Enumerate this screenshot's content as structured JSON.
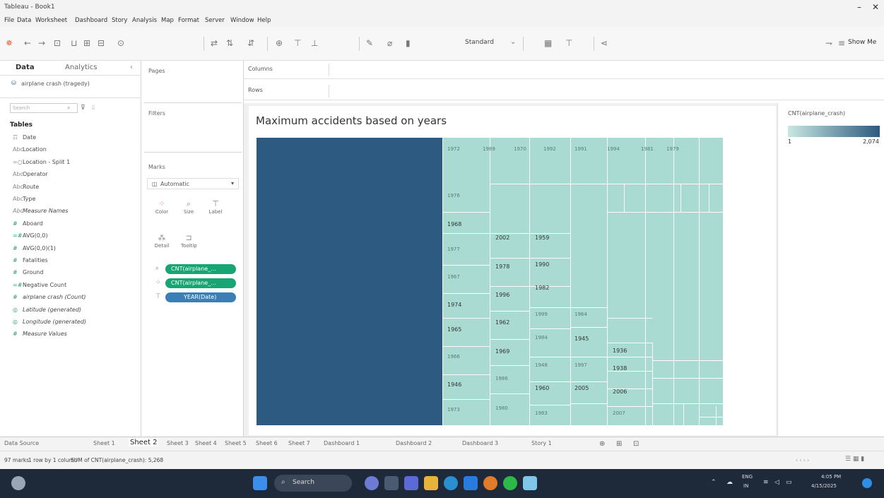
{
  "window": {
    "title": "Tableau - Book1",
    "minimize": "–",
    "close": "✕"
  },
  "menu": [
    "File",
    "Data",
    "Worksheet",
    "Dashboard",
    "Story",
    "Analysis",
    "Map",
    "Format",
    "Server",
    "Window",
    "Help"
  ],
  "toolbar": {
    "fit": "Standard",
    "show_me": "Show Me"
  },
  "left_panel": {
    "tab_data": "Data",
    "tab_analytics": "Analytics",
    "datasource": "airplane crash (tragedy)",
    "search_placeholder": "Search",
    "tables_header": "Tables",
    "fields": [
      {
        "icon": "calendar-icon",
        "glyph": "☶",
        "label": "Date",
        "italic": false
      },
      {
        "icon": "string-icon",
        "glyph": "Abc",
        "label": "Location",
        "italic": false
      },
      {
        "icon": "split-icon",
        "glyph": "=○",
        "label": "Location - Split 1",
        "italic": false
      },
      {
        "icon": "string-icon",
        "glyph": "Abc",
        "label": "Operator",
        "italic": false
      },
      {
        "icon": "string-icon",
        "glyph": "Abc",
        "label": "Route",
        "italic": false
      },
      {
        "icon": "string-icon",
        "glyph": "Abc",
        "label": "Type",
        "italic": false
      },
      {
        "icon": "string-icon",
        "glyph": "Abc",
        "label": "Measure Names",
        "italic": true
      },
      {
        "icon": "measure-icon",
        "glyph": "#",
        "label": "Aboard",
        "italic": false
      },
      {
        "icon": "calc-icon",
        "glyph": "=#",
        "label": "AVG(0,0)",
        "italic": false
      },
      {
        "icon": "measure-icon",
        "glyph": "#",
        "label": "AVG(0,0)(1)",
        "italic": false
      },
      {
        "icon": "measure-icon",
        "glyph": "#",
        "label": "Fatalities",
        "italic": false
      },
      {
        "icon": "measure-icon",
        "glyph": "#",
        "label": "Ground",
        "italic": false
      },
      {
        "icon": "calc-icon",
        "glyph": "=#",
        "label": "Negative Count",
        "italic": false
      },
      {
        "icon": "measure-icon",
        "glyph": "#",
        "label": "airplane crash (Count)",
        "italic": true
      },
      {
        "icon": "geo-icon",
        "glyph": "◎",
        "label": "Latitude (generated)",
        "italic": true
      },
      {
        "icon": "geo-icon",
        "glyph": "◎",
        "label": "Longitude (generated)",
        "italic": true
      },
      {
        "icon": "measure-icon",
        "glyph": "#",
        "label": "Measure Values",
        "italic": true
      }
    ]
  },
  "cards": {
    "pages": "Pages",
    "filters": "Filters",
    "marks": "Marks",
    "mark_type": "Automatic",
    "buttons": [
      "Color",
      "Size",
      "Label",
      "Detail",
      "Tooltip"
    ],
    "pills": [
      {
        "label": "CNT(airplane_...",
        "color": "green"
      },
      {
        "label": "CNT(airplane_...",
        "color": "green"
      },
      {
        "label": "YEAR(Date)",
        "color": "blue"
      }
    ]
  },
  "shelves": {
    "columns": "Columns",
    "rows": "Rows"
  },
  "chart_data": {
    "type": "treemap",
    "title": "Maximum accidents based on years",
    "visible_year_labels": [
      "1972",
      "1989",
      "1970",
      "1992",
      "1991",
      "1994",
      "1981",
      "1979",
      "1976",
      "1968",
      "1977",
      "1967",
      "1974",
      "1965",
      "1966",
      "1946",
      "1973",
      "2002",
      "1978",
      "1996",
      "1962",
      "1969",
      "1986",
      "1980",
      "1959",
      "1990",
      "1982",
      "1999",
      "1984",
      "1948",
      "1960",
      "1983",
      "1964",
      "1945",
      "1997",
      "2005",
      "1936",
      "1938",
      "2006",
      "2007"
    ],
    "legend": {
      "title": "CNT(airplane_crash)",
      "min": "1",
      "max": "2,074",
      "color_min": "#c8e8e2",
      "color_max": "#2c5a80"
    }
  },
  "sheet_tabs": [
    "Data Source",
    "Sheet 1",
    "Sheet 2",
    "Sheet 3",
    "Sheet 4",
    "Sheet 5",
    "Sheet 6",
    "Sheet 7",
    "Dashboard 1",
    "Dashboard 2",
    "Dashboard 3",
    "Story 1"
  ],
  "active_tab": "Sheet 2",
  "status": {
    "marks": "97 marks",
    "rows_cols": "1 row by 1 column",
    "sum": "SUM of CNT(airplane_crash): 5,268"
  },
  "taskbar": {
    "search": "Search",
    "lang": "ENG",
    "region": "IN",
    "time": "4:05 PM",
    "date": "4/15/2025"
  }
}
